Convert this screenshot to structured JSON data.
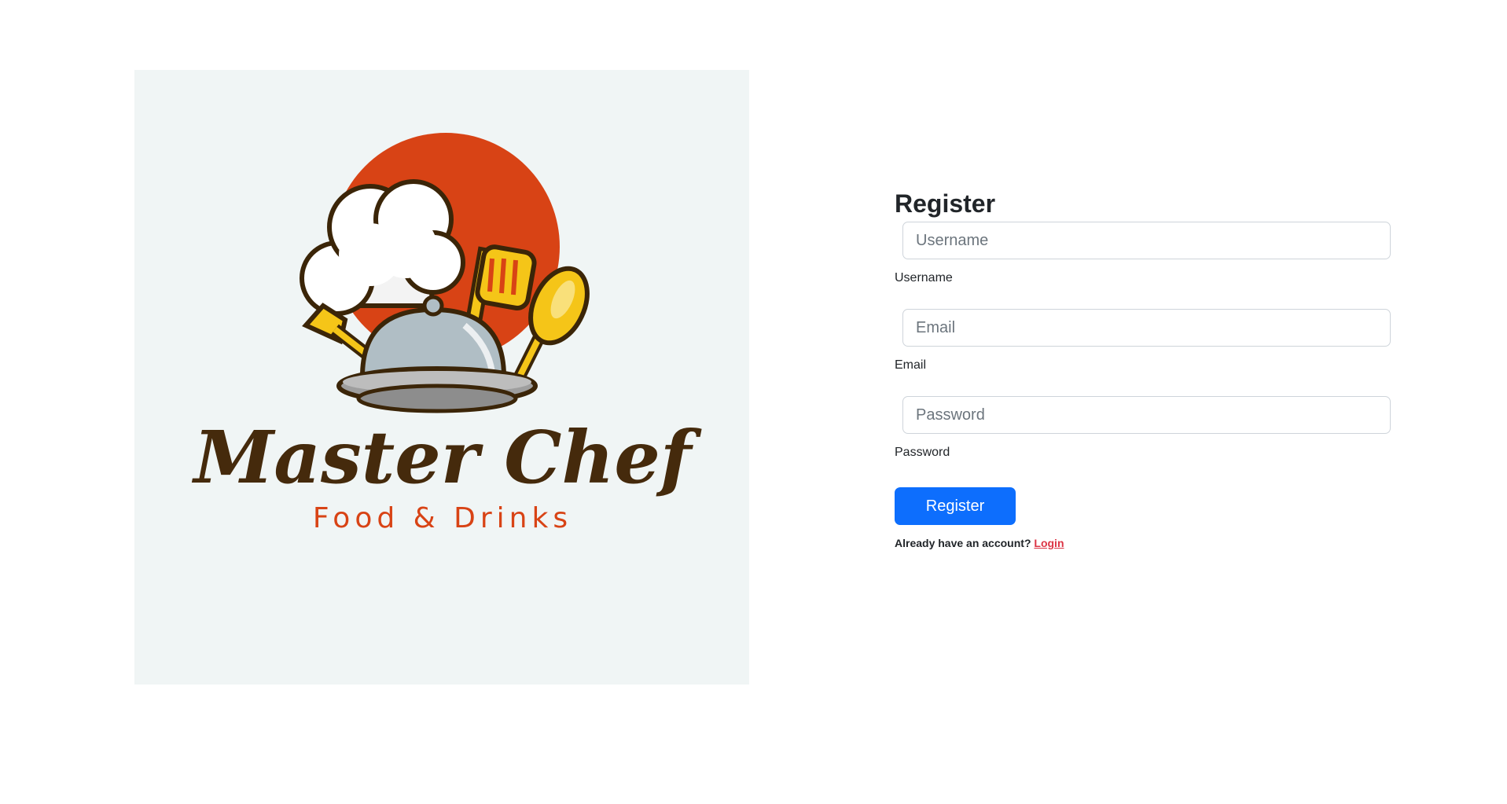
{
  "logo": {
    "brand_name": "Master Chef",
    "tagline": "Food & Drinks",
    "colors": {
      "circle": "#d84315",
      "brand_text": "#452a0c",
      "tagline_text": "#d84315",
      "utensils": "#f5c518",
      "cloche": "#b0bec5"
    }
  },
  "form": {
    "title": "Register",
    "fields": [
      {
        "placeholder": "Username",
        "label": "Username"
      },
      {
        "placeholder": "Email",
        "label": "Email"
      },
      {
        "placeholder": "Password",
        "label": "Password"
      }
    ],
    "submit_label": "Register",
    "login_prompt": "Already have an account?",
    "login_link": "Login",
    "colors": {
      "button": "#0d6efd",
      "link": "#dc3545"
    }
  }
}
